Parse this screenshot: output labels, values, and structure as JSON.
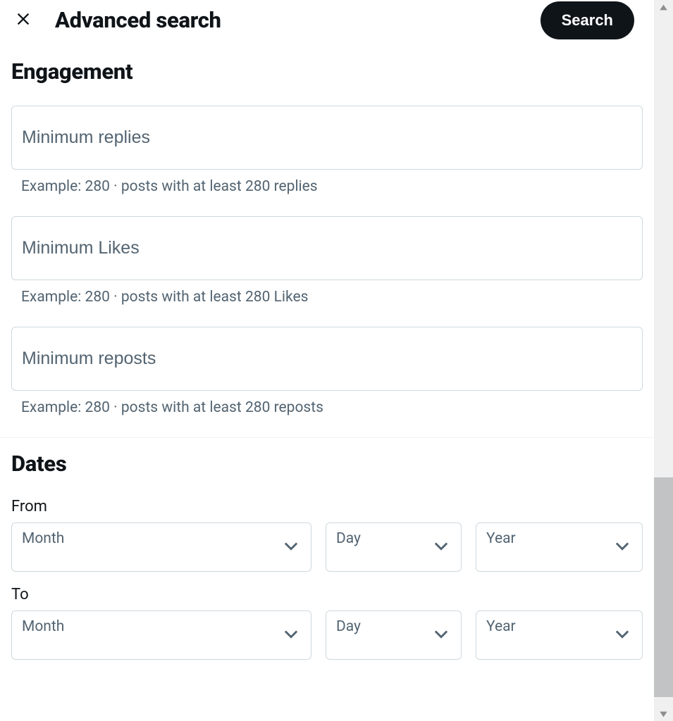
{
  "header": {
    "title": "Advanced search",
    "search_button": "Search"
  },
  "engagement": {
    "title": "Engagement",
    "fields": [
      {
        "placeholder": "Minimum replies",
        "help": "Example: 280 · posts with at least 280 replies"
      },
      {
        "placeholder": "Minimum Likes",
        "help": "Example: 280 · posts with at least 280 Likes"
      },
      {
        "placeholder": "Minimum reposts",
        "help": "Example: 280 · posts with at least 280 reposts"
      }
    ]
  },
  "dates": {
    "title": "Dates",
    "from_label": "From",
    "to_label": "To",
    "month_label": "Month",
    "day_label": "Day",
    "year_label": "Year"
  }
}
